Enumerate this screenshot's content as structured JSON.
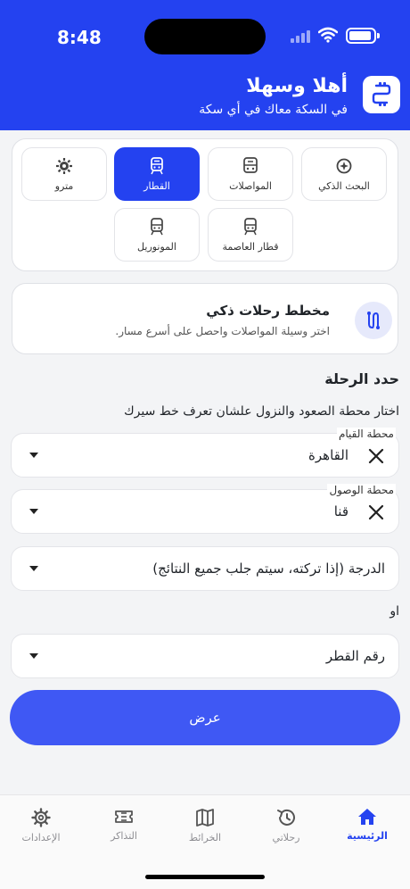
{
  "status_bar": {
    "time": "8:48"
  },
  "header": {
    "title": "أهلا وسهلا",
    "subtitle": "في السكة معاك في أي سكة"
  },
  "modes": [
    {
      "label": "البحث الذكي",
      "icon": "smart-search-icon",
      "active": false
    },
    {
      "label": "المواصلات",
      "icon": "transport-icon",
      "active": false
    },
    {
      "label": "القطار",
      "icon": "train-icon",
      "active": true
    },
    {
      "label": "مترو",
      "icon": "metro-icon",
      "active": false
    },
    {
      "label": "قطار العاصمة",
      "icon": "capital-train-icon",
      "active": false
    },
    {
      "label": "المونوريل",
      "icon": "monorail-icon",
      "active": false
    }
  ],
  "planner": {
    "title": "مخطط رحلات ذكي",
    "subtitle": "اختر وسيلة المواصلات واحصل على أسرع مسار.",
    "icon": "route-icon"
  },
  "trip": {
    "title": "حدد الرحلة",
    "subtitle": "اختار محطة الصعود والنزول علشان تعرف خط سيرك",
    "departure_label": "محطة القيام",
    "departure_value": "القاهرة",
    "arrival_label": "محطة الوصول",
    "arrival_value": "قنا",
    "class_placeholder": "الدرجة (إذا تركته، سيتم جلب جميع النتائج)",
    "or_text": "او",
    "train_number_placeholder": "رقم القطر",
    "submit_label": "عرض"
  },
  "tabs": [
    {
      "label": "الرئيسية",
      "icon": "home-icon",
      "active": true
    },
    {
      "label": "رحلاتي",
      "icon": "history-icon",
      "active": false
    },
    {
      "label": "الخرائط",
      "icon": "map-icon",
      "active": false
    },
    {
      "label": "التذاكر",
      "icon": "ticket-icon",
      "active": false
    },
    {
      "label": "الإعدادات",
      "icon": "gear-icon",
      "active": false
    }
  ],
  "colors": {
    "primary": "#2442f0",
    "button": "#3f58f4",
    "background": "#f3f4f6"
  }
}
